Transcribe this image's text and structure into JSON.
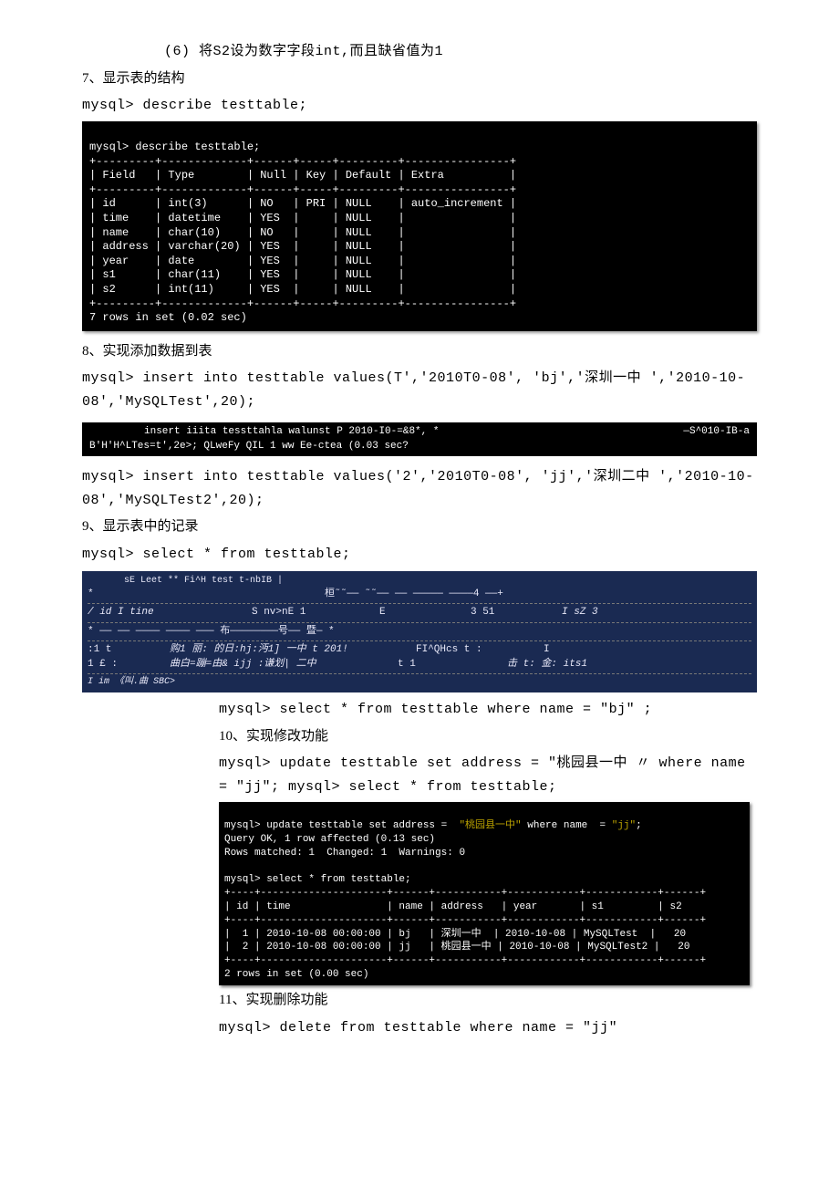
{
  "line_6": "(6)    将S2设为数字字段int,而且缺省值为1",
  "s7_title": "7、显示表的结构",
  "s7_cmd": "mysql> describe testtable;",
  "term1": {
    "l1": "mysql> describe testtable;",
    "sep": "+---------+-------------+------+-----+---------+----------------+",
    "hdr": "| Field   | Type        | Null | Key | Default | Extra          |",
    "r1": "| id      | int(3)      | NO   | PRI | NULL    | auto_increment |",
    "r2": "| time    | datetime    | YES  |     | NULL    |                |",
    "r3": "| name    | char(10)    | NO   |     | NULL    |                |",
    "r4": "| address | varchar(20) | YES  |     | NULL    |                |",
    "r5": "| year    | date        | YES  |     | NULL    |                |",
    "r6": "| s1      | char(11)    | YES  |     | NULL    |                |",
    "r7": "| s2      | int(11)     | YES  |     | NULL    |                |",
    "foot": "7 rows in set (0.02 sec)"
  },
  "s8_title": "8、实现添加数据到表",
  "s8_cmd": "mysql> insert into testtable values(T','2010T0-08', 'bj','深圳一中 ','2010-10-08','MySQLTest',20);",
  "term_ins": {
    "l1_left": "insert iiita tessttahla walunst P 2010-I0-=&8*, *",
    "l1_right": "—S^010-IB-a",
    "l2": "B'H'H^LTes=t',2e>; QLweFy QIL 1 ww Ee-ctea (0.03 sec?"
  },
  "s8_cmd2": "mysql> insert into testtable values('2','2010T0-08', 'jj','深圳二中 ','2010-10-08','MySQLTest2',20);",
  "s9_title": "9、显示表中的记录",
  "s9_cmd": "mysql> select * from testtable;",
  "term_sel": {
    "h0": "sE Leet ** Fi^H test t-nbIB |",
    "blob1": "*",
    "blob1r": "桓˜˜——  ˜˜——  —— ————— ————4 ——+",
    "hdr_c1": "/ id I tine",
    "hdr_c2": "S nv>nE 1",
    "hdr_c3": "E",
    "hdr_c4": "3 51",
    "hdr_c5": "I sZ 3",
    "mid_l": "* —— —— ———— ———— ——— 布————————号——     暨—    *",
    "r1_c1": ":1   t",
    "r1_c2": "购1 丽:  的日:hj:沔1] 一中  t 201!",
    "r1_c3": "FI^QHcs t   :",
    "r1_c4": "I",
    "r2_c1": "1 £  :",
    "r2_c2": "曲白=蹦=由& ijj :谦划|  二中",
    "r2_c3": "t       1",
    "r2_c4": "击 t: 金: its1",
    "foot": "I     im 《叫.曲 SBC>"
  },
  "s9_cmd2": "mysql> select * from testtable where name = \"bj\"  ;",
  "s10_title": "10、实现修改功能",
  "s10_cmd": "mysql> update testtable set address = \"桃园县一中 〃 where name = \"jj\"; mysql> select * from testtable;",
  "term3": {
    "l1": "mysql> update testtable set address =  \"桃园县一中\" where name  = \"jj\";",
    "l2": "Query OK, 1 row affected (0.13 sec)",
    "l3": "Rows matched: 1  Changed: 1  Warnings: 0",
    "l4": "",
    "l5": "mysql> select * from testtable;",
    "sep": "+----+---------------------+------+-----------+------------+------------+------+",
    "hdr": "| id | time                | name | address   | year       | s1         | s2",
    "r1": "|  1 | 2010-10-08 00:00:00 | bj   | 深圳一中  | 2010-10-08 | MySQLTest  |   20",
    "r2": "|  2 | 2010-10-08 00:00:00 | jj   | 桃园县一中 | 2010-10-08 | MySQLTest2 |   20",
    "foot": "2 rows in set (0.00 sec)"
  },
  "s11_title": "11、实现删除功能",
  "s11_cmd": "mysql> delete from testtable where name = \"jj\""
}
